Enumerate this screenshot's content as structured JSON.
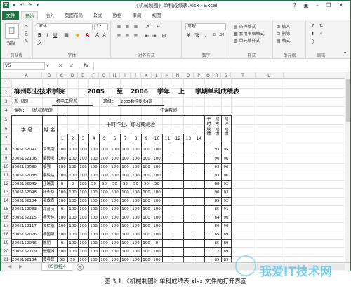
{
  "window": {
    "title": "《机械制图》单科成绩表.xlsx - Excel",
    "help": "?",
    "login": "登录"
  },
  "tabs": [
    "文件",
    "开始",
    "插入",
    "页面布局",
    "公式",
    "数据",
    "审阅",
    "视图"
  ],
  "ribbon": {
    "paste": "粘贴",
    "clipboard_label": "剪贴板",
    "font_name": "宋体",
    "font_size": "12",
    "font_label": "字体",
    "align_label": "对齐方式",
    "number_format": "常规",
    "number_label": "数字",
    "cond_format": "条件格式",
    "table_format": "套用表格格式",
    "cell_style": "单元格样式",
    "style_label": "样式",
    "insert": "插入",
    "delete": "删除",
    "format": "格式",
    "cells_label": "单元格",
    "edit_label": "编辑"
  },
  "formula_bar": {
    "name_box": "V5",
    "fx": "fx",
    "value": ""
  },
  "columns": [
    "A",
    "B",
    "C",
    "D",
    "E",
    "F",
    "G",
    "H",
    "I",
    "J",
    "K",
    "L",
    "M",
    "N",
    "O",
    "P",
    "Q",
    "R",
    "S",
    "T",
    "U"
  ],
  "rows": [
    "1",
    "2",
    "3",
    "4",
    "5",
    "6",
    "7",
    "8",
    "9",
    "10",
    "11",
    "12",
    "13",
    "14",
    "15",
    "16",
    "17",
    "18",
    "19",
    "20",
    "21"
  ],
  "sheet": {
    "title_school": "柳州职业技术学院",
    "year_from": "2005",
    "to": "至",
    "year_to": "2006",
    "xuenian": "学年",
    "term": "上",
    "term_suffix": "学期单科成绩表",
    "dept_label": "系（部）:",
    "dept": "机电工程系",
    "class_label": "班级：",
    "class_name": "2005数控技术4班",
    "course_label": "课程：",
    "course": "《机械制图》",
    "teacher_label": "任课教师：",
    "h_id": "学 号",
    "h_name": "姓 名",
    "h_group": "平时作业、练习或测验",
    "h_nums": [
      "1",
      "2",
      "3",
      "4",
      "5",
      "6",
      "7",
      "8",
      "9",
      "10",
      "11",
      "12",
      "13",
      "14"
    ],
    "h_p": "平时成绩",
    "h_q": "期考成绩",
    "h_r": "期评成绩",
    "students": [
      {
        "id": "2005152097",
        "name": "覃溪南",
        "s": [
          "100",
          "100",
          "100",
          "100",
          "100",
          "100",
          "100",
          "100",
          "100",
          "100"
        ],
        "q": "93",
        "r": "95"
      },
      {
        "id": "2005152106",
        "name": "梁毅淞",
        "s": [
          "100",
          "100",
          "100",
          "100",
          "100",
          "100",
          "100",
          "100",
          "100",
          "100"
        ],
        "q": "90",
        "r": "96"
      },
      {
        "id": "2005152080",
        "name": "黎强",
        "s": [
          "100",
          "100",
          "100",
          "100",
          "100",
          "100",
          "100",
          "100",
          "100",
          "100"
        ],
        "q": "93",
        "r": "96"
      },
      {
        "id": "2005152088",
        "name": "李俊达",
        "s": [
          "100",
          "100",
          "100",
          "100",
          "100",
          "100",
          "100",
          "100",
          "100",
          "100"
        ],
        "q": "93",
        "r": "96"
      },
      {
        "id": "2005152049",
        "name": "汪瑞勇",
        "s": [
          "0",
          "0",
          "100",
          "50",
          "50",
          "50",
          "50",
          "50",
          "50",
          "50"
        ],
        "q": "88",
        "r": "92"
      },
      {
        "id": "2005152098",
        "name": "叶长华",
        "s": [
          "100",
          "100",
          "100",
          "100",
          "100",
          "100",
          "100",
          "100",
          "100",
          "100"
        ],
        "q": "90",
        "r": "93"
      },
      {
        "id": "2005152104",
        "name": "吴成表",
        "s": [
          "100",
          "100",
          "100",
          "100",
          "100",
          "100",
          "100",
          "100",
          "100",
          "100"
        ],
        "q": "85",
        "r": "92"
      },
      {
        "id": "2005152083",
        "name": "邓育庆",
        "s": [
          "0",
          "100",
          "100",
          "100",
          "100",
          "100",
          "100",
          "100",
          "100",
          "100"
        ],
        "q": "85",
        "r": "91"
      },
      {
        "id": "2005152115",
        "name": "杨天纯",
        "s": [
          "100",
          "100",
          "100",
          "100",
          "100",
          "100",
          "100",
          "100",
          "100",
          "100"
        ],
        "q": "84",
        "r": "90"
      },
      {
        "id": "2005152117",
        "name": "黄仁航",
        "s": [
          "100",
          "100",
          "100",
          "100",
          "100",
          "100",
          "100",
          "100",
          "100",
          "100"
        ],
        "q": "80",
        "r": "90"
      },
      {
        "id": "2005152076",
        "name": "杨国阳",
        "s": [
          "100",
          "100",
          "100",
          "100",
          "100",
          "100",
          "100",
          "100",
          "100",
          "100"
        ],
        "q": "85",
        "r": "89"
      },
      {
        "id": "2005152046",
        "name": "陈朋",
        "s": [
          "0",
          "100",
          "100",
          "100",
          "100",
          "100",
          "100",
          "100",
          "100",
          "0"
        ],
        "q": "85",
        "r": "89"
      },
      {
        "id": "2005152119",
        "name": "张耀城",
        "s": [
          "100",
          "100",
          "100",
          "100",
          "100",
          "100",
          "100",
          "100",
          "100",
          "100"
        ],
        "q": "77",
        "r": "89"
      },
      {
        "id": "2005152134",
        "name": "黄兵营",
        "s": [
          "50",
          "50",
          "100",
          "100",
          "100",
          "100",
          "100",
          "100",
          "100",
          "100"
        ],
        "q": "85",
        "r": "89"
      }
    ]
  },
  "sheet_tab": "05数控4",
  "caption": "图 3.1 《机械制图》单科成绩表.xlsx 文件的打开界面",
  "watermark": "我爱IT技术网"
}
